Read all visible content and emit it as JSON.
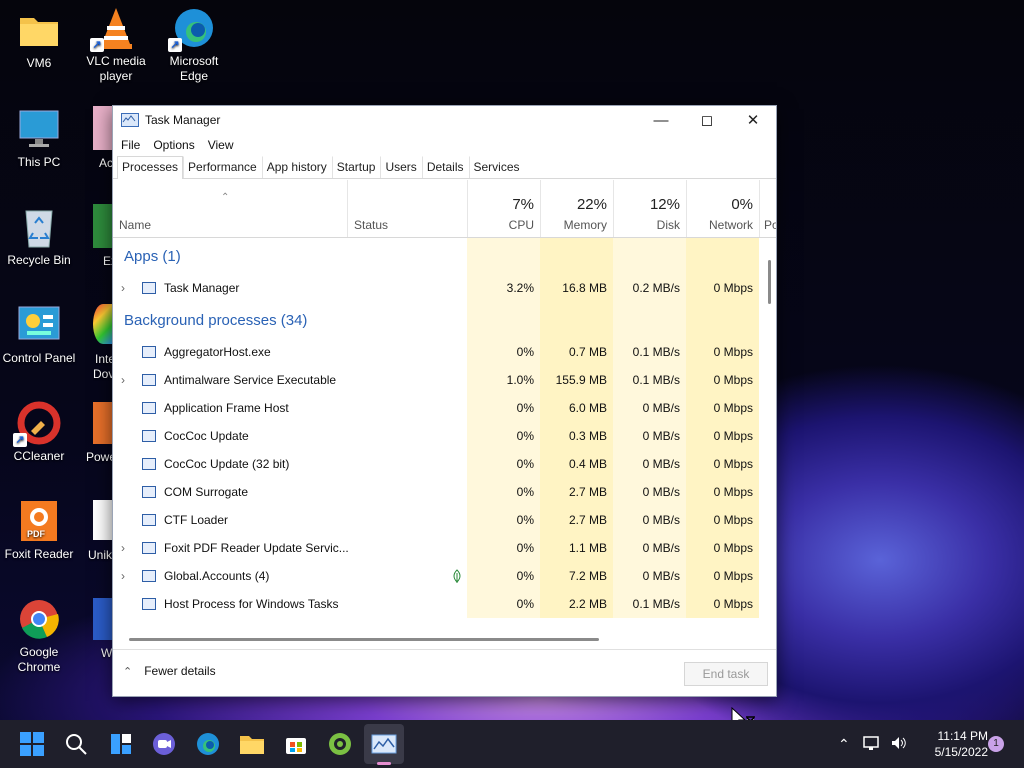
{
  "desktop": {
    "icons": [
      {
        "label1": "VM6",
        "label2": ""
      },
      {
        "label1": "VLC media",
        "label2": "player"
      },
      {
        "label1": "Microsoft",
        "label2": "Edge"
      },
      {
        "label1": "This PC",
        "label2": ""
      },
      {
        "label1": "Recycle Bin",
        "label2": ""
      },
      {
        "label1": "Control Panel",
        "label2": ""
      },
      {
        "label1": "CCleaner",
        "label2": ""
      },
      {
        "label1": "Foxit Reader",
        "label2": ""
      },
      {
        "label1": "Google",
        "label2": "Chrome"
      }
    ],
    "partial_labels": [
      "Ac",
      "Ex",
      "Inte",
      "Dov",
      "Powe",
      "Unik",
      "W"
    ]
  },
  "window": {
    "title": "Task Manager",
    "menu": [
      "File",
      "Options",
      "View"
    ],
    "tabs": [
      "Processes",
      "Performance",
      "App history",
      "Startup",
      "Users",
      "Details",
      "Services"
    ],
    "active_tab": "Processes",
    "columns": {
      "name": "Name",
      "status": "Status",
      "cpu": {
        "pct": "7%",
        "label": "CPU"
      },
      "memory": {
        "pct": "22%",
        "label": "Memory"
      },
      "disk": {
        "pct": "12%",
        "label": "Disk"
      },
      "network": {
        "pct": "0%",
        "label": "Network"
      },
      "power_partial": "Po"
    },
    "groups": {
      "apps": "Apps (1)",
      "background": "Background processes (34)"
    },
    "apps": [
      {
        "name": "Task Manager",
        "cpu": "3.2%",
        "memory": "16.8 MB",
        "disk": "0.2 MB/s",
        "network": "0 Mbps",
        "expandable": true
      }
    ],
    "background": [
      {
        "name": "AggregatorHost.exe",
        "cpu": "0%",
        "memory": "0.7 MB",
        "disk": "0.1 MB/s",
        "network": "0 Mbps",
        "expandable": false
      },
      {
        "name": "Antimalware Service Executable",
        "cpu": "1.0%",
        "memory": "155.9 MB",
        "disk": "0.1 MB/s",
        "network": "0 Mbps",
        "expandable": true
      },
      {
        "name": "Application Frame Host",
        "cpu": "0%",
        "memory": "6.0 MB",
        "disk": "0 MB/s",
        "network": "0 Mbps",
        "expandable": false
      },
      {
        "name": "CocCoc Update",
        "cpu": "0%",
        "memory": "0.3 MB",
        "disk": "0 MB/s",
        "network": "0 Mbps",
        "expandable": false
      },
      {
        "name": "CocCoc Update (32 bit)",
        "cpu": "0%",
        "memory": "0.4 MB",
        "disk": "0 MB/s",
        "network": "0 Mbps",
        "expandable": false
      },
      {
        "name": "COM Surrogate",
        "cpu": "0%",
        "memory": "2.7 MB",
        "disk": "0 MB/s",
        "network": "0 Mbps",
        "expandable": false
      },
      {
        "name": "CTF Loader",
        "cpu": "0%",
        "memory": "2.7 MB",
        "disk": "0 MB/s",
        "network": "0 Mbps",
        "expandable": false
      },
      {
        "name": "Foxit PDF Reader Update Servic...",
        "cpu": "0%",
        "memory": "1.1 MB",
        "disk": "0 MB/s",
        "network": "0 Mbps",
        "expandable": true
      },
      {
        "name": "Global.Accounts (4)",
        "cpu": "0%",
        "memory": "7.2 MB",
        "disk": "0 MB/s",
        "network": "0 Mbps",
        "expandable": true,
        "status_icon": "leaf-icon"
      },
      {
        "name": "Host Process for Windows Tasks",
        "cpu": "0%",
        "memory": "2.2 MB",
        "disk": "0.1 MB/s",
        "network": "0 Mbps",
        "expandable": false
      }
    ],
    "footer": {
      "fewer_details": "Fewer details",
      "end_task": "End task"
    }
  },
  "taskbar": {
    "time": "11:14 PM",
    "date": "5/15/2022",
    "notification_count": "1"
  }
}
